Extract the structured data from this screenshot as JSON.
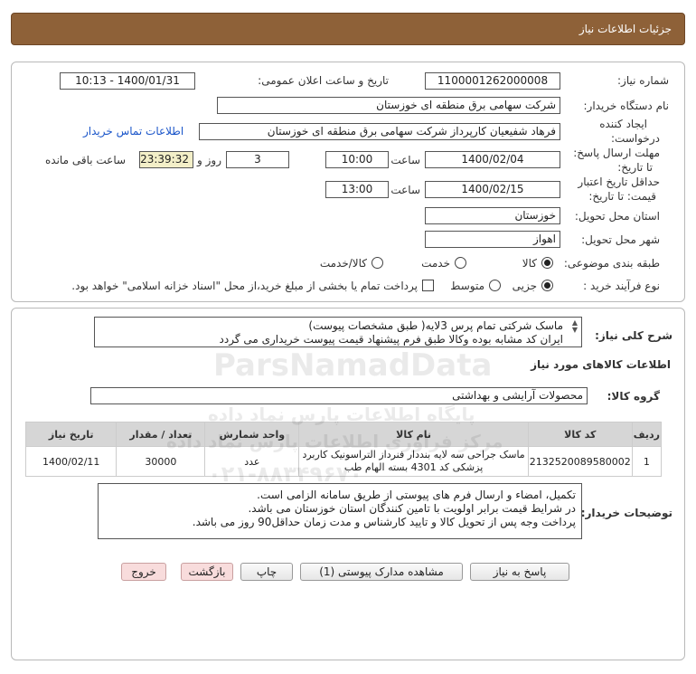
{
  "header": {
    "title": "جزئیات اطلاعات نیاز"
  },
  "form": {
    "need_number_label": "شماره نیاز:",
    "need_number": "1100001262000008",
    "announce_label": "تاریخ و ساعت اعلان عمومی:",
    "announce_value": "1400/01/31 - 10:13",
    "buyer_org_label": "نام دستگاه خریدار:",
    "buyer_org": "شرکت سهامی برق منطقه ای خوزستان",
    "requester_label_1": "ایجاد کننده",
    "requester_label_2": "درخواست:",
    "requester": "فرهاد شفیعیان کارپرداز شرکت سهامی برق منطقه ای خوزستان",
    "contact_link": "اطلاعات تماس خریدار",
    "deadline_label_1": "مهلت ارسال پاسخ:",
    "deadline_label_2": "تا تاریخ:",
    "deadline_date": "1400/02/04",
    "time_label": "ساعت",
    "deadline_time": "10:00",
    "days_value": "3",
    "days_label": "روز و",
    "remaining_time": "23:39:32",
    "remaining_label": "ساعت باقی مانده",
    "validity_label_1": "حداقل تاریخ اعتبار",
    "validity_label_2": "قیمت: تا تاریخ:",
    "validity_date": "1400/02/15",
    "validity_time": "13:00",
    "province_label": "استان محل تحویل:",
    "province": "خوزستان",
    "city_label": "شهر محل تحویل:",
    "city": "اهواز",
    "category_label": "طبقه بندی موضوعی:",
    "category_options": [
      "کالا",
      "خدمت",
      "کالا/خدمت"
    ],
    "process_label": "نوع فرآیند خرید :",
    "process_options": [
      "جزیی",
      "متوسط"
    ],
    "payment_note": "پرداخت تمام یا بخشی از مبلغ خرید،از محل \"اسناد خزانه اسلامی\" خواهد بود."
  },
  "description": {
    "label": "شرح کلی نیاز:",
    "line1": "ماسک شرکتی تمام پرس 3لایه( طبق مشخصات پیوست)",
    "line2": "ایران کد مشابه بوده وکالا طبق فرم پیشنهاد قیمت پیوست خریداری می گردد"
  },
  "goods": {
    "section_title": "اطلاعات کالاهای مورد نیاز",
    "group_label": "گروه کالا:",
    "group_value": "محصولات آرایشی و بهداشتی",
    "columns": [
      "ردیف",
      "کد کالا",
      "نام کالا",
      "واحد شمارش",
      "تعداد / مقدار",
      "تاریخ نیاز"
    ],
    "rows": [
      {
        "index": "1",
        "code": "2132520089580002",
        "name_line1": "ماسک جراحی سه لایه بنددار فنرداز التراسونیک کاربرد",
        "name_line2": "پزشکی کد 4301 بسته الهام طب",
        "unit": "عدد",
        "qty": "30000",
        "date": "1400/02/11"
      }
    ]
  },
  "buyer_notes": {
    "label": "توضیحات خریدار:",
    "line1": "تکمیل، امضاء و ارسال فرم های پیوستی از طریق سامانه الزامی است.",
    "line2": "در شرایط  قیمت برابر اولویت با تامین کنندگان استان خوزستان می باشد.",
    "line3": "پرداخت وجه پس از تحویل کالا و تایید کارشناس و مدت زمان حداقل90 روز می باشد."
  },
  "buttons": {
    "reply": "پاسخ به نیاز",
    "attachments": "مشاهده مدارک پیوستی (1)",
    "print": "چاپ",
    "back": "بازگشت",
    "exit": "خروج"
  },
  "watermark": {
    "brand": "ParsNamadData",
    "fa_line1": "پایگاه اطلاعات پارس نماد داده",
    "fa_line2": "مرکز فراوری اطلاعات پارس نماد داده",
    "phone": "۰۲۱-۸۸۳۴۹۶۷۰"
  }
}
